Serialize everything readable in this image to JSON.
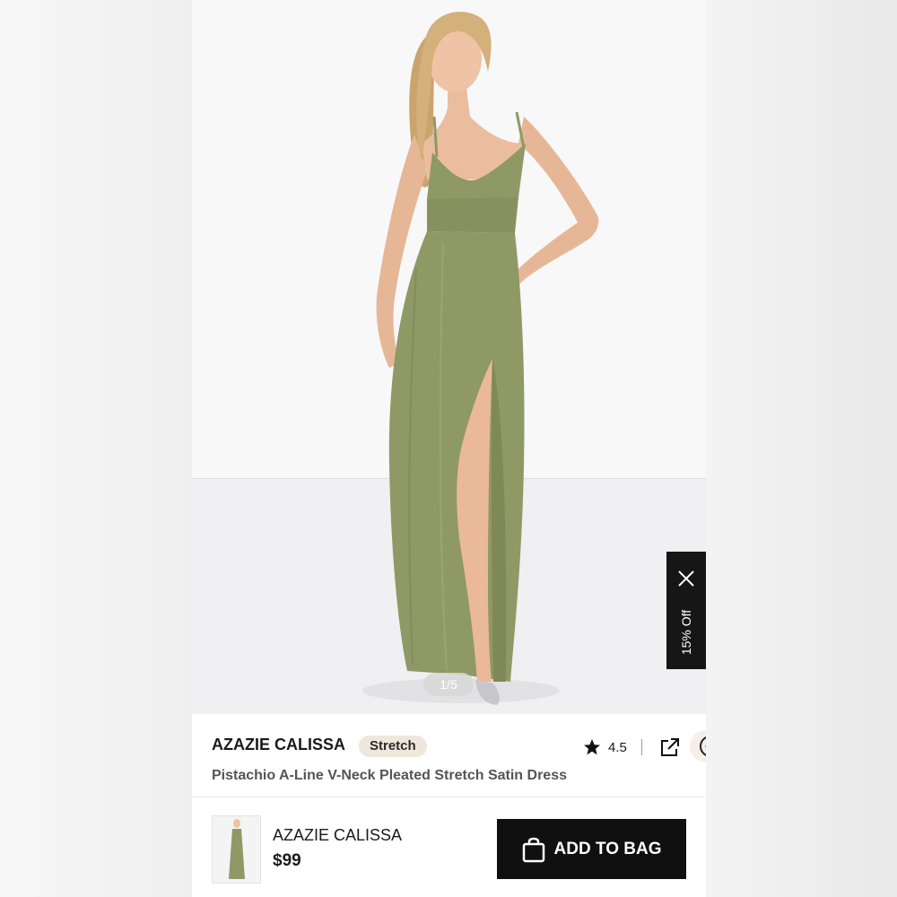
{
  "gallery": {
    "counter": "1/5",
    "promo_label": "15% Off"
  },
  "product": {
    "brand": "AZAZIE CALISSA",
    "badge": "Stretch",
    "title": "Pistachio A-Line V-Neck Pleated Stretch Satin Dress",
    "rating": "4.5"
  },
  "bottom_bar": {
    "name": "AZAZIE CALISSA",
    "price": "$99",
    "add_label": "ADD TO BAG"
  },
  "colors": {
    "dress": "#8f9966",
    "dark": "#101010",
    "badge_bg": "#efe6dc"
  },
  "icons": [
    "close-icon",
    "star-icon",
    "share-icon",
    "more-icon",
    "bag-icon"
  ]
}
